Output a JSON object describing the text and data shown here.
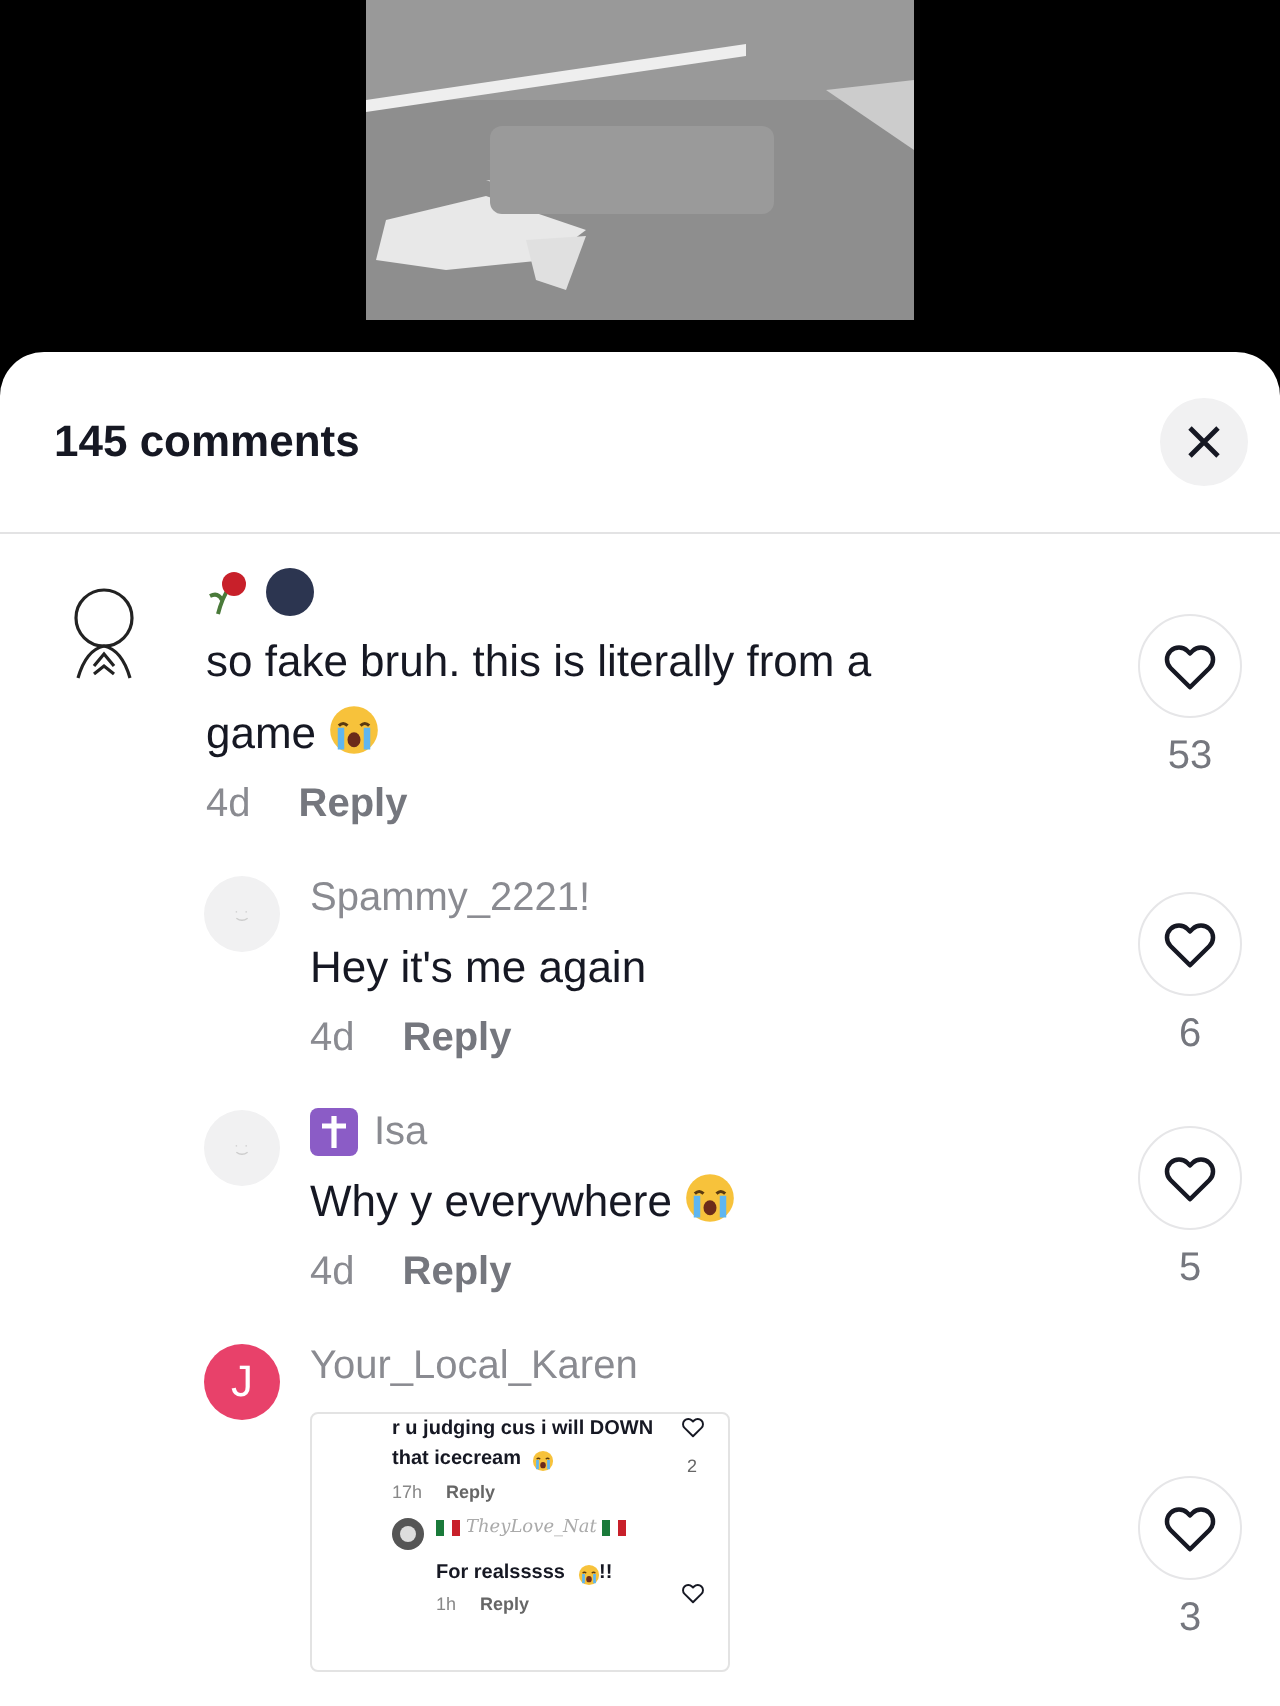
{
  "sheet": {
    "title": "145 comments"
  },
  "comments": [
    {
      "avatar": {
        "kind": "sketch"
      },
      "name": {
        "kind": "icons"
      },
      "text": "so fake bruh. this is literally from a game",
      "crying": true,
      "time": "4d",
      "reply": "Reply",
      "likes": "53",
      "liked": false,
      "children": [
        {
          "avatar": {
            "kind": "blank"
          },
          "name": {
            "kind": "text",
            "text": "Spammy_2221!"
          },
          "badge": false,
          "text": "Hey it's me again",
          "crying": false,
          "time": "4d",
          "reply": "Reply",
          "likes": "6",
          "liked": false
        },
        {
          "avatar": {
            "kind": "blank"
          },
          "name": {
            "kind": "text",
            "text": "Isa"
          },
          "badge": true,
          "text": "Why y everywhere",
          "crying": true,
          "time": "4d",
          "reply": "Reply",
          "likes": "5",
          "liked": false
        },
        {
          "avatar": {
            "kind": "letter",
            "letter": "J",
            "color": "#e8416a"
          },
          "name": {
            "kind": "text",
            "text": "Your_Local_Karen"
          },
          "badge": false,
          "likes": "3",
          "liked": false,
          "attachment": {
            "kind": "screenshot",
            "text": "r u judging cus i will DOWN that icecream",
            "crying": true,
            "likes": "2",
            "time": "17h",
            "reply": "Reply",
            "reply_comment": {
              "name": "TheyLove_Nat",
              "text": "For realsssss",
              "after": "!!",
              "time": "1h",
              "reply": "Reply"
            }
          }
        }
      ]
    }
  ]
}
